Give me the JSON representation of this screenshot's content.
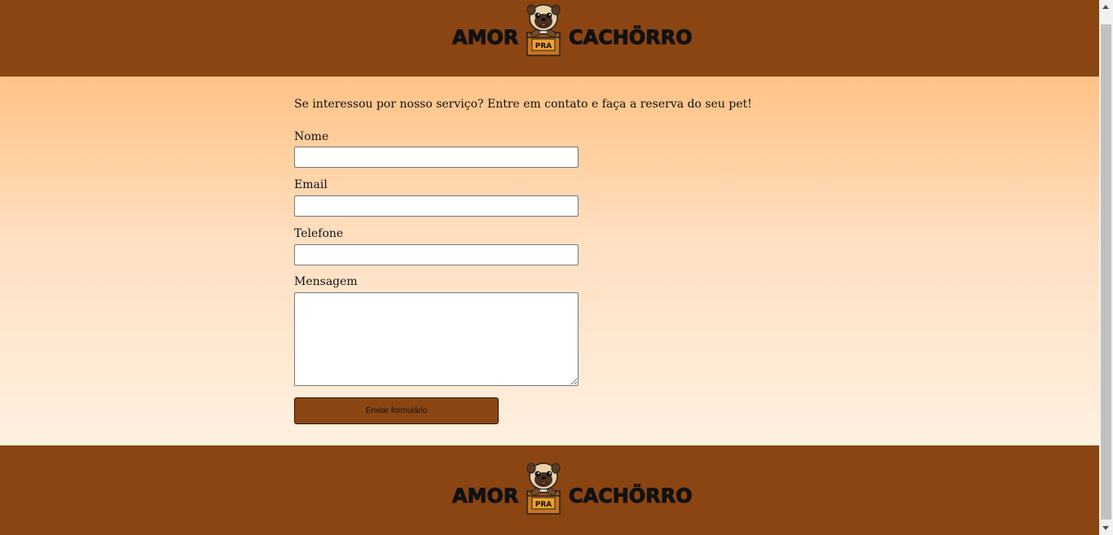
{
  "brand": {
    "word_left": "AMOR",
    "word_middle": "PRA",
    "word_right": "CACHÖRRO"
  },
  "form": {
    "intro": "Se interessou por nosso serviço? Entre em contato e faça a reserva do seu pet!",
    "name_label": "Nome",
    "name_value": "",
    "email_label": "Email",
    "email_value": "",
    "phone_label": "Telefone",
    "phone_value": "",
    "message_label": "Mensagem",
    "message_value": "",
    "submit_label": "Enviar formulário"
  },
  "colors": {
    "brand_brown": "#8b4513",
    "gradient_top": "#ffc285",
    "gradient_bottom": "#fff0e0"
  },
  "icons": {
    "mascot": "pug-in-box-icon",
    "scroll_up": "arrow-up-icon",
    "scroll_down": "arrow-down-icon"
  }
}
